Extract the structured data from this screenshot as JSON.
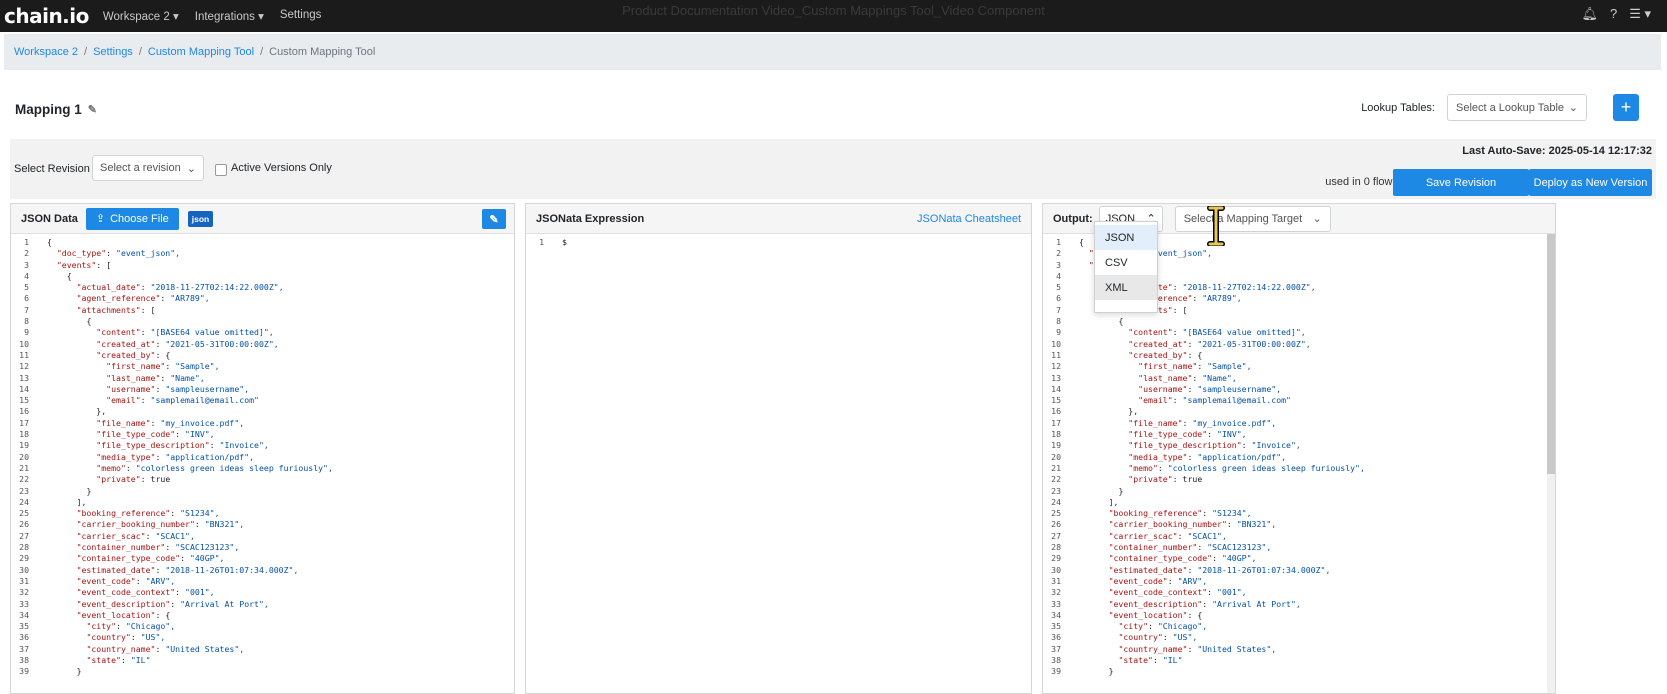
{
  "app": {
    "logo": "chain.io",
    "nav": [
      "Workspace 2",
      "Integrations",
      "Settings"
    ],
    "window_title": "Product Documentation Video_Custom Mappings Tool_Video Component"
  },
  "breadcrumb": [
    "Workspace 2",
    "Settings",
    "Custom Mapping Tool",
    "Custom Mapping Tool"
  ],
  "mapping": {
    "title": "Mapping 1"
  },
  "lookup": {
    "label": "Lookup Tables:",
    "placeholder": "Select a Lookup Table",
    "add": "+"
  },
  "revision": {
    "label": "Select Revision",
    "placeholder": "Select a revision",
    "active_only": "Active Versions Only",
    "last_autosave": "Last Auto-Save: 2025-05-14 12:17:32",
    "used_in": "used in 0 flows",
    "save": "Save Revision",
    "deploy": "Deploy as New Version"
  },
  "json_pane": {
    "title": "JSON Data",
    "choose_file": "Choose File",
    "badge": "json"
  },
  "expr_pane": {
    "title": "JSONata Expression",
    "cheatsheet": "JSONata Cheatsheet",
    "lines": [
      "$"
    ]
  },
  "output_pane": {
    "title": "Output:",
    "format": "JSON",
    "target_placeholder": "Select a Mapping Target",
    "options": [
      "JSON",
      "CSV",
      "XML"
    ]
  },
  "code_lines": [
    [
      0,
      "",
      "{"
    ],
    [
      1,
      "doc_type",
      "\"event_json\","
    ],
    [
      1,
      "events",
      "["
    ],
    [
      2,
      "",
      "{"
    ],
    [
      3,
      "actual_date",
      "\"2018-11-27T02:14:22.000Z\","
    ],
    [
      3,
      "agent_reference",
      "\"AR789\","
    ],
    [
      3,
      "attachments",
      "["
    ],
    [
      4,
      "",
      "{"
    ],
    [
      5,
      "content",
      "\"[BASE64 value omitted]\","
    ],
    [
      5,
      "created_at",
      "\"2021-05-31T00:00:00Z\","
    ],
    [
      5,
      "created_by",
      "{"
    ],
    [
      6,
      "first_name",
      "\"Sample\","
    ],
    [
      6,
      "last_name",
      "\"Name\","
    ],
    [
      6,
      "username",
      "\"sampleusername\","
    ],
    [
      6,
      "email",
      "\"samplemail@email.com\""
    ],
    [
      5,
      "",
      "},"
    ],
    [
      5,
      "file_name",
      "\"my_invoice.pdf\","
    ],
    [
      5,
      "file_type_code",
      "\"INV\","
    ],
    [
      5,
      "file_type_description",
      "\"Invoice\","
    ],
    [
      5,
      "media_type",
      "\"application/pdf\","
    ],
    [
      5,
      "memo",
      "\"colorless green ideas sleep furiously\","
    ],
    [
      5,
      "private",
      "true"
    ],
    [
      4,
      "",
      "}"
    ],
    [
      3,
      "",
      "],"
    ],
    [
      3,
      "booking_reference",
      "\"S1234\","
    ],
    [
      3,
      "carrier_booking_number",
      "\"BN321\","
    ],
    [
      3,
      "carrier_scac",
      "\"SCAC1\","
    ],
    [
      3,
      "container_number",
      "\"SCAC123123\","
    ],
    [
      3,
      "container_type_code",
      "\"40GP\","
    ],
    [
      3,
      "estimated_date",
      "\"2018-11-26T01:07:34.000Z\","
    ],
    [
      3,
      "event_code",
      "\"ARV\","
    ],
    [
      3,
      "event_code_context",
      "\"001\","
    ],
    [
      3,
      "event_description",
      "\"Arrival At Port\","
    ],
    [
      3,
      "event_location",
      "{"
    ],
    [
      4,
      "city",
      "\"Chicago\","
    ],
    [
      4,
      "country",
      "\"US\","
    ],
    [
      4,
      "country_name",
      "\"United States\","
    ],
    [
      4,
      "state",
      "\"IL\""
    ],
    [
      3,
      "",
      "}"
    ]
  ]
}
